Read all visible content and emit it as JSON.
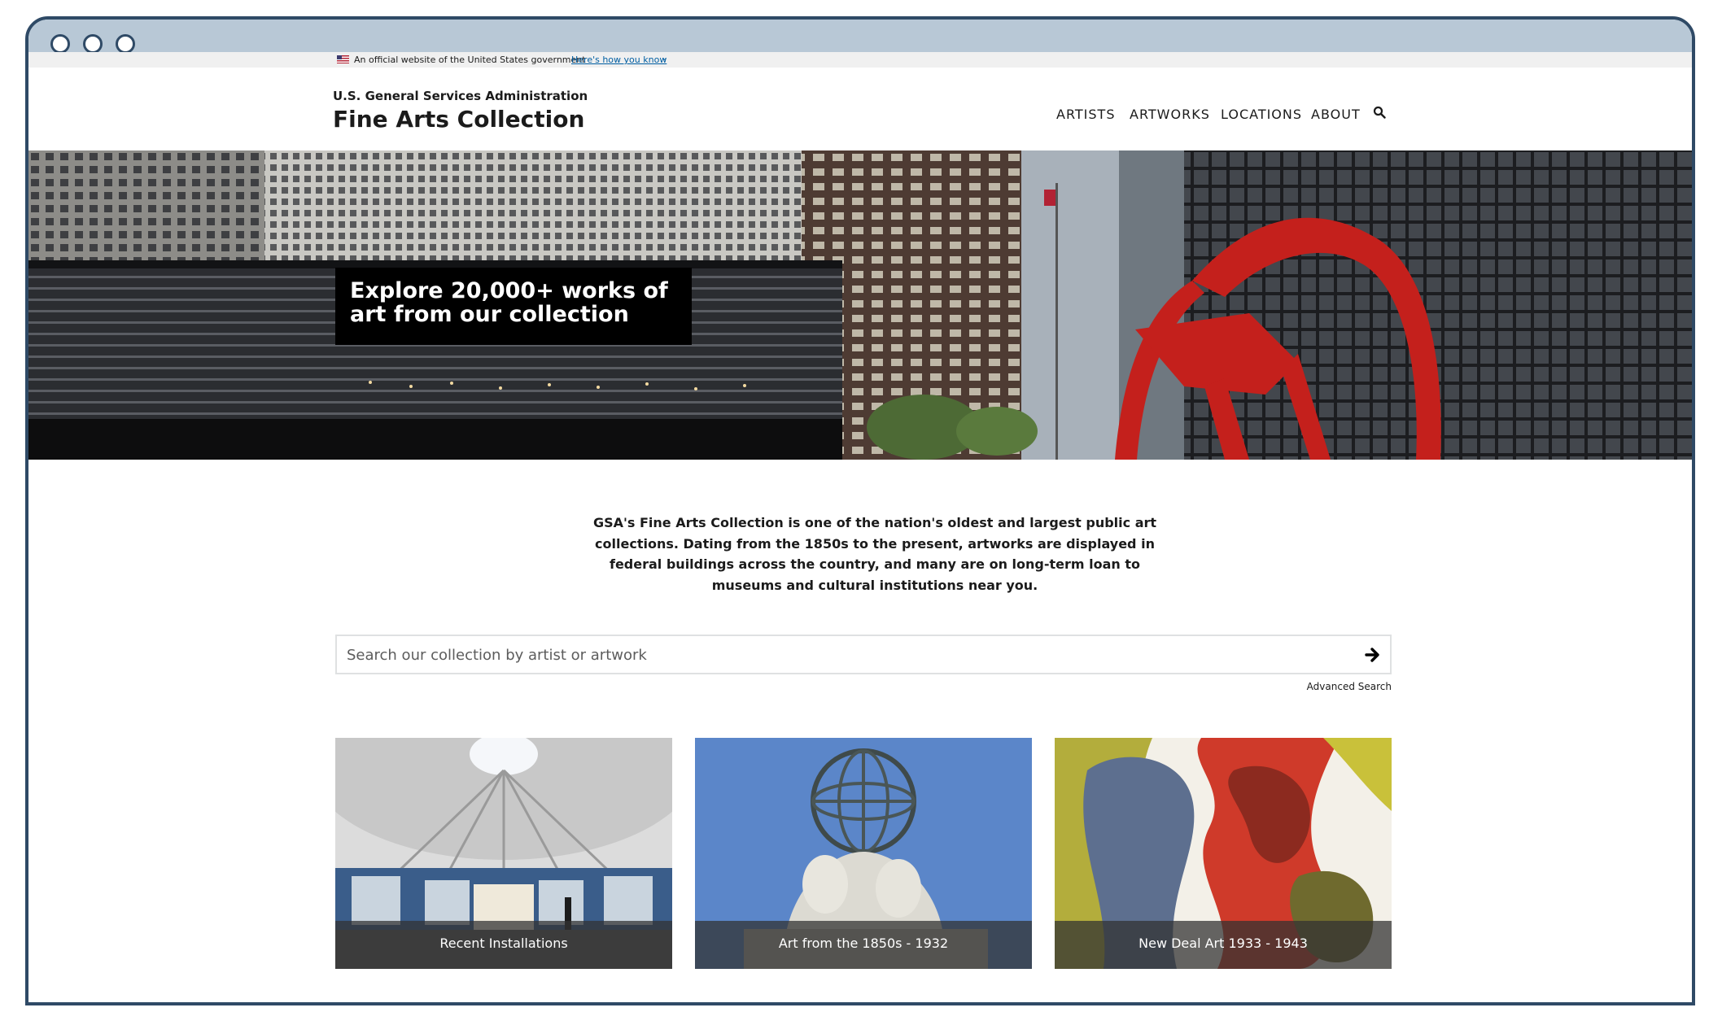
{
  "gov_banner": {
    "text": "An official website of the United States government",
    "link": "Here's how you know"
  },
  "header": {
    "agency": "U.S. General Services Administration",
    "title": "Fine Arts Collection"
  },
  "nav": {
    "items": [
      "ARTISTS",
      "ARTWORKS",
      "LOCATIONS",
      "ABOUT"
    ],
    "search_icon": "search-icon"
  },
  "hero": {
    "title": "Explore 20,000+ works of art from our collection"
  },
  "intro": {
    "text": "GSA's Fine Arts Collection is one of the nation's oldest and largest public art collections. Dating from the 1850s to the present, artworks are displayed in federal buildings across the country, and many are on long-term loan to museums and cultural institutions near you."
  },
  "search": {
    "placeholder": "Search our collection by artist or artwork",
    "submit_icon": "arrow-right-icon",
    "advanced_label": "Advanced Search"
  },
  "cards": [
    {
      "label": "Recent Installations"
    },
    {
      "label": "Art from the 1850s - 1932"
    },
    {
      "label": "New Deal Art 1933 - 1943"
    }
  ],
  "colors": {
    "window_border": "#2f4a66",
    "chrome_bar": "#b8c8d6",
    "gov_link": "#005ea2",
    "hero_box": "#000000",
    "sculpture_red": "#c4201c"
  }
}
